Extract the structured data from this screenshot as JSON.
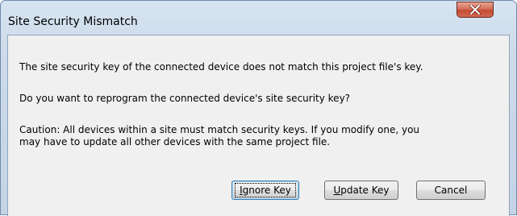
{
  "dialog": {
    "title": "Site Security Mismatch",
    "close_icon": "close-x-icon",
    "messages": {
      "line1": "The site security key of the connected device does not match this project file's key.",
      "line2": "Do you want to reprogram the connected device's site security key?",
      "line3a": "Caution:  All devices within a site must match security keys.  If you modify one, you",
      "line3b": "may have to update all other devices with the same project file."
    },
    "buttons": {
      "ignore": {
        "mnemonic": "I",
        "rest": "gnore Key"
      },
      "update": {
        "mnemonic": "U",
        "rest": "pdate Key"
      },
      "cancel": "Cancel"
    }
  },
  "colors": {
    "close_button": "#c44a32",
    "client_bg": "#f0f0f0",
    "frame": "#cddbea",
    "default_button_border": "#3c7fb1"
  }
}
